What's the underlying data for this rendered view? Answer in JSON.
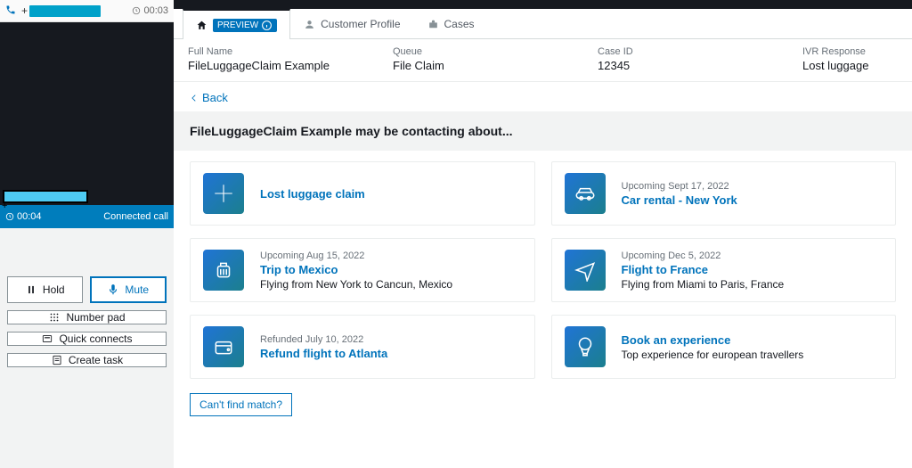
{
  "call": {
    "header_timer": "00:03",
    "status_timer": "00:04",
    "status_text": "Connected call"
  },
  "controls": {
    "hold": "Hold",
    "mute": "Mute",
    "numpad": "Number pad",
    "quick": "Quick connects",
    "task": "Create task"
  },
  "tabs": {
    "home_badge": "PREVIEW",
    "profile": "Customer Profile",
    "cases": "Cases"
  },
  "info": {
    "name_lbl": "Full Name",
    "name_val": "FileLuggageClaim Example",
    "queue_lbl": "Queue",
    "queue_val": "File Claim",
    "case_lbl": "Case ID",
    "case_val": "12345",
    "ivr_lbl": "IVR Response",
    "ivr_val": "Lost luggage"
  },
  "back": "Back",
  "contacting": "FileLuggageClaim Example may be contacting about...",
  "cards": [
    {
      "meta": "",
      "title": "Lost luggage claim",
      "sub": ""
    },
    {
      "meta": "Upcoming Sept 17, 2022",
      "title": "Car rental - New York",
      "sub": ""
    },
    {
      "meta": "Upcoming Aug 15, 2022",
      "title": "Trip to Mexico",
      "sub": "Flying from New York to Cancun, Mexico"
    },
    {
      "meta": "Upcoming Dec 5, 2022",
      "title": "Flight to France",
      "sub": "Flying from Miami to Paris, France"
    },
    {
      "meta": "Refunded July 10, 2022",
      "title": "Refund flight to Atlanta",
      "sub": ""
    },
    {
      "meta": "",
      "title": "Book an experience",
      "sub": "Top experience for european travellers"
    }
  ],
  "nomatch": "Can't find match?"
}
